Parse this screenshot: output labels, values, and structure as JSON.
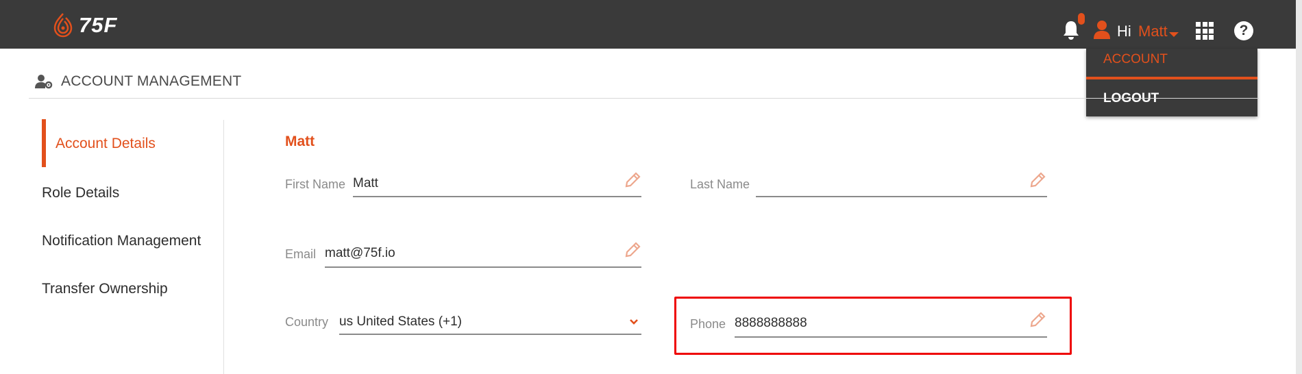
{
  "colors": {
    "accent": "#e2501c",
    "topbar": "#3a3a3a",
    "highlight": "#ee0000"
  },
  "header": {
    "brand": "75F",
    "greeting": "Hi",
    "user_name": "Matt",
    "icons": [
      "logo-icon",
      "bell-icon",
      "user-icon",
      "caret-down-icon",
      "apps-grid-icon",
      "help-icon"
    ]
  },
  "user_menu": {
    "items": [
      "ACCOUNT",
      "LOGOUT"
    ],
    "active": "ACCOUNT"
  },
  "page": {
    "title": "ACCOUNT MANAGEMENT"
  },
  "sidebar": {
    "items": [
      {
        "label": "Account Details",
        "active": true
      },
      {
        "label": "Role Details",
        "active": false
      },
      {
        "label": "Notification Management",
        "active": false
      },
      {
        "label": "Transfer Ownership",
        "active": false
      }
    ]
  },
  "form": {
    "section_title": "Matt",
    "first_name": {
      "label": "First Name",
      "value": "Matt"
    },
    "last_name": {
      "label": "Last Name",
      "value": ""
    },
    "email": {
      "label": "Email",
      "value": "matt@75f.io"
    },
    "country": {
      "label": "Country",
      "value": "us United States (+1)"
    },
    "phone": {
      "label": "Phone",
      "value": "8888888888"
    }
  }
}
